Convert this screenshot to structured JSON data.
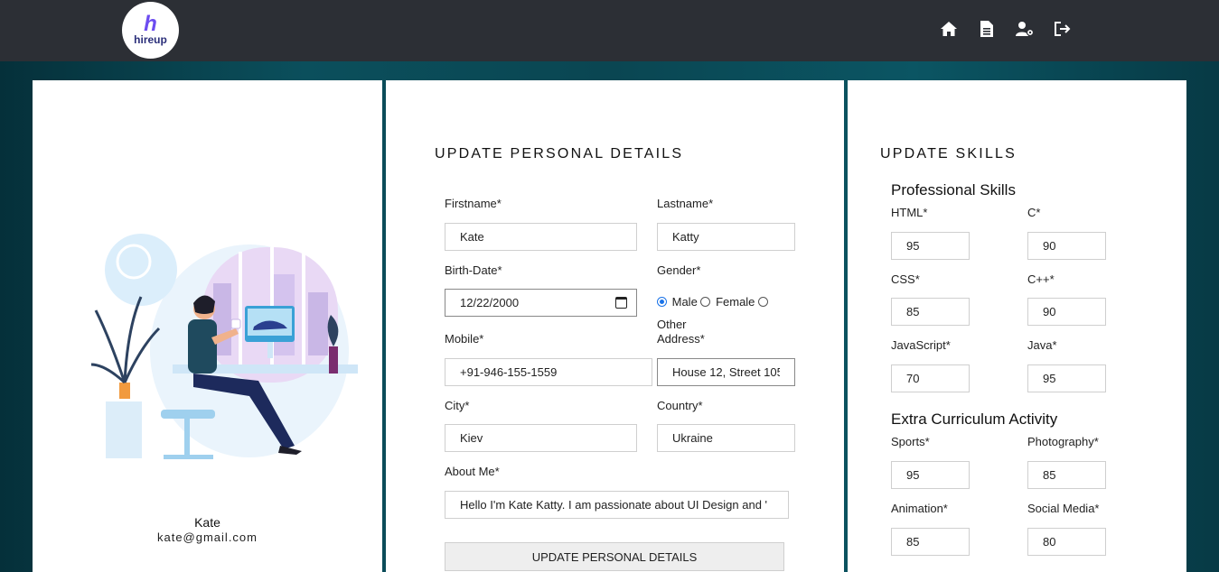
{
  "brand": {
    "logo_mark": "h",
    "logo_word": "hireup"
  },
  "nav": {
    "icons": [
      "home-icon",
      "document-icon",
      "user-settings-icon",
      "logout-icon"
    ]
  },
  "profile": {
    "name": "Kate",
    "email": "kate@gmail.com"
  },
  "personal": {
    "title": "UPDATE PERSONAL DETAILS",
    "firstname_label": "Firstname*",
    "firstname_value": "Kate",
    "lastname_label": "Lastname*",
    "lastname_value": "Katty",
    "birthdate_label": "Birth-Date*",
    "birthdate_value": "12/22/2000",
    "gender_label": "Gender*",
    "gender_options": [
      "Male",
      "Female",
      "Other"
    ],
    "gender_selected": "Male",
    "mobile_label": "Mobile*",
    "mobile_value": "+91-946-155-1559",
    "address_label": "Address*",
    "address_value": "House 12, Street 105",
    "city_label": "City*",
    "city_value": "Kiev",
    "country_label": "Country*",
    "country_value": "Ukraine",
    "about_label": "About Me*",
    "about_value": "Hello I'm Kate Katty. I am passionate about UI Design and '",
    "submit_label": "UPDATE PERSONAL DETAILS"
  },
  "skills": {
    "title": "UPDATE SKILLS",
    "professional_title": "Professional Skills",
    "html_label": "HTML*",
    "html_value": "95",
    "c_label": "C*",
    "c_value": "90",
    "css_label": "CSS*",
    "css_value": "85",
    "cpp_label": "C++*",
    "cpp_value": "90",
    "js_label": "JavaScript*",
    "js_value": "70",
    "java_label": "Java*",
    "java_value": "95",
    "extra_title": "Extra Curriculum Activity",
    "sports_label": "Sports*",
    "sports_value": "95",
    "photo_label": "Photography*",
    "photo_value": "85",
    "anim_label": "Animation*",
    "anim_value": "85",
    "social_label": "Social Media*",
    "social_value": "80"
  },
  "colors": {
    "topbar": "#2c2f35",
    "accent": "#6c4cf0",
    "radio": "#1a73e8"
  }
}
